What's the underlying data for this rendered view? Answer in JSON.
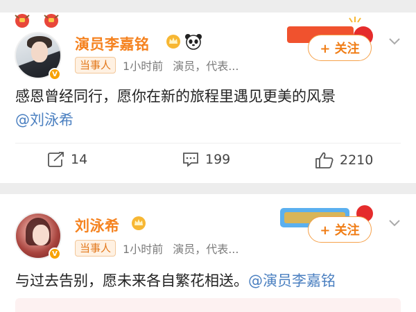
{
  "post1": {
    "author": "演员李嘉铭",
    "tag": "当事人",
    "time": "1小时前",
    "meta_desc": "演员，代表...",
    "follow_label": "+ 关注",
    "text": "感恩曾经同行，愿你在新的旅程里遇见更美的风景",
    "mention": "@刘泳希",
    "repost_count": "14",
    "comment_count": "199",
    "like_count": "2210",
    "icons": [
      "verified-v-icon",
      "crown-icon",
      "panda-icon",
      "chevron-down-icon",
      "repost-icon",
      "comment-icon",
      "like-icon"
    ]
  },
  "post2": {
    "author": "刘泳希",
    "tag": "当事人",
    "time": "1小时前",
    "meta_desc": "演员，代表...",
    "follow_label": "+ 关注",
    "text": "与过去告别，愿未来各自繁花相送。",
    "mention": "@演员李嘉铭",
    "icons": [
      "verified-v-icon",
      "crown-icon",
      "chevron-down-icon"
    ]
  },
  "colors": {
    "name": "#f5821f",
    "mention": "#4a7fc0",
    "verified": "#f8a200",
    "background": "#ededed"
  }
}
